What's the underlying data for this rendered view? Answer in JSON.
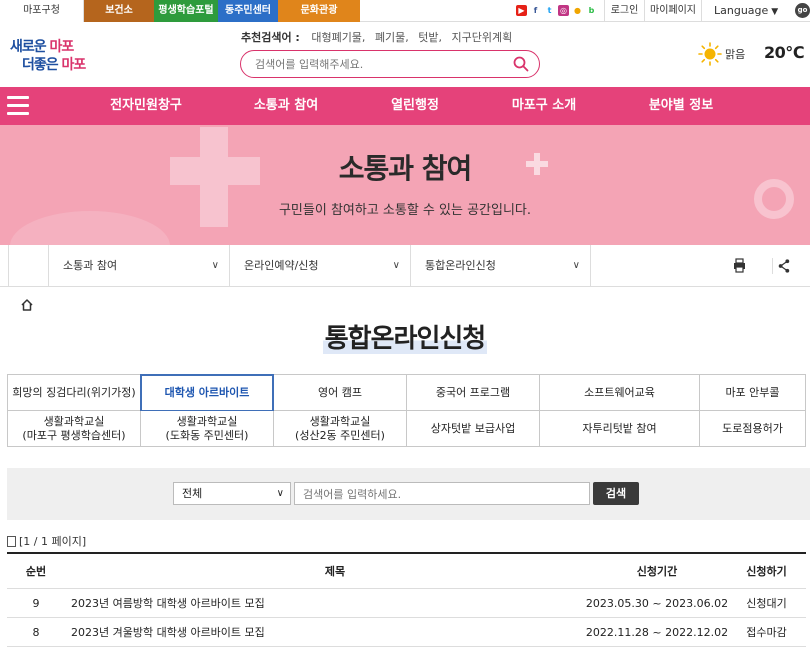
{
  "top_bar": {
    "site_tabs": [
      "마포구청",
      "보건소",
      "평생학습포털",
      "동주민센터",
      "문화관광"
    ],
    "login": "로그인",
    "mypage": "마이페이지",
    "language": "Language",
    "go": "go"
  },
  "header": {
    "logo_line1_a": "새로운 ",
    "logo_line1_b": "마포",
    "logo_line2_a": "더좋은 ",
    "logo_line2_b": "마포",
    "recommend_label": "추천검색어 :",
    "recommend_terms": [
      "대형폐기물,",
      "폐기물,",
      "텃밭,",
      "지구단위계획"
    ],
    "search_placeholder": "검색어를 입력해주세요.",
    "weather_condition": "맑음",
    "temperature": "20℃"
  },
  "gnb": {
    "items": [
      "전자민원창구",
      "소통과 참여",
      "열린행정",
      "마포구 소개",
      "분야별 정보"
    ]
  },
  "banner": {
    "title": "소통과 참여",
    "subtitle": "구민들이 참여하고 소통할 수 있는 공간입니다."
  },
  "location": {
    "levels": [
      "소통과 참여",
      "온라인예약/신청",
      "통합온라인신청"
    ]
  },
  "page": {
    "title": "통합온라인신청"
  },
  "categories": {
    "row1": [
      "희망의 징검다리(위기가정)",
      "대학생 아르바이트",
      "영어 캠프",
      "중국어 프로그램",
      "소프트웨어교육",
      "마포 안부콜"
    ],
    "row2_line1": [
      "생활과학교실",
      "생활과학교실",
      "생활과학교실",
      "상자텃밭 보급사업",
      "자투리텃밭 참여",
      "도로점용허가"
    ],
    "row2_line2": [
      "(마포구 평생학습센터)",
      "(도화동 주민센터)",
      "(성산2동 주민센터)",
      "",
      "",
      ""
    ],
    "active_index": 1
  },
  "search": {
    "select_value": "전체",
    "keyword_placeholder": "검색어를 입력하세요.",
    "button": "검색"
  },
  "list": {
    "page_info": "[1 / 1 페이지]",
    "headers": {
      "no": "순번",
      "title": "제목",
      "period": "신청기간",
      "apply": "신청하기"
    },
    "rows": [
      {
        "no": "9",
        "title": "2023년 여름방학 대학생 아르바이트 모집",
        "period": "2023.05.30 ~ 2023.06.02",
        "apply": "신청대기"
      },
      {
        "no": "8",
        "title": "2023년 겨울방학 대학생 아르바이트 모집",
        "period": "2022.11.28 ~ 2022.12.02",
        "apply": "접수마감"
      }
    ]
  },
  "colors": {
    "brand_pink": "#e5427a",
    "banner_pink": "#f4a4b5",
    "active_blue": "#1e56b0"
  }
}
